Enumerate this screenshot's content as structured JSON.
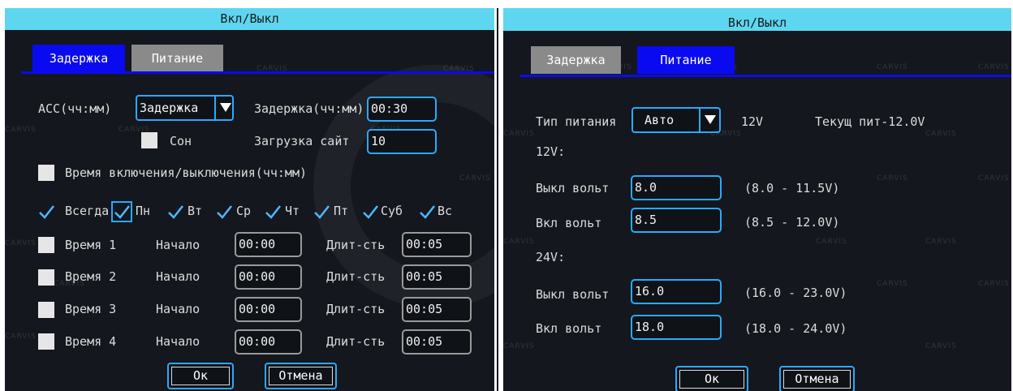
{
  "left": {
    "title": "Вкл/Выкл",
    "tabs": {
      "delay": "Задержка",
      "power": "Питание"
    },
    "acc_label": "ACC(чч:мм)",
    "acc_mode": "Задержка",
    "delay_label": "Задержка(чч:мм)",
    "delay_value": "00:30",
    "sleep_label": "Сон",
    "upload_label": "Загрузка сайт",
    "upload_value": "10",
    "schedule_label": "Время включения/выключения(чч:мм)",
    "days": {
      "always": "Всегда",
      "mon": "Пн",
      "tue": "Вт",
      "wed": "Ср",
      "thu": "Чт",
      "fri": "Пт",
      "sat": "Суб",
      "sun": "Вс"
    },
    "time_rows": [
      {
        "label": "Время 1",
        "start_label": "Начало",
        "start": "00:00",
        "dur_label": "Длит-сть",
        "dur": "00:05"
      },
      {
        "label": "Время 2",
        "start_label": "Начало",
        "start": "00:00",
        "dur_label": "Длит-сть",
        "dur": "00:05"
      },
      {
        "label": "Время 3",
        "start_label": "Начало",
        "start": "00:00",
        "dur_label": "Длит-сть",
        "dur": "00:05"
      },
      {
        "label": "Время 4",
        "start_label": "Начало",
        "start": "00:00",
        "dur_label": "Длит-сть",
        "dur": "00:05"
      }
    ],
    "ok": "Ок",
    "cancel": "Отмена"
  },
  "right": {
    "title": "Вкл/Выкл",
    "tabs": {
      "delay": "Задержка",
      "power": "Питание"
    },
    "power_type_label": "Тип питания",
    "power_type_value": "Авто",
    "power_voltage": "12V",
    "current_voltage": "Текущ пит-12.0V",
    "v12_header": "12V:",
    "v12_off_label": "Выкл вольт",
    "v12_off_value": "8.0",
    "v12_off_range": "(8.0 - 11.5V)",
    "v12_on_label": "Вкл вольт",
    "v12_on_value": "8.5",
    "v12_on_range": "(8.5 - 12.0V)",
    "v24_header": "24V:",
    "v24_off_label": "Выкл вольт",
    "v24_off_value": "16.0",
    "v24_off_range": "(16.0 - 23.0V)",
    "v24_on_label": "Вкл вольт",
    "v24_on_value": "18.0",
    "v24_on_range": "(18.0 - 24.0V)",
    "ok": "Ок",
    "cancel": "Отмена"
  },
  "watermark": "CARVIS",
  "colors": {
    "background": "#14171d",
    "titlebar": "#5fd6f0",
    "accent_blue": "#2aa9ff",
    "tab_active": "#0a0af0",
    "tab_inactive": "#8a8a8a"
  },
  "icons": {
    "check": "check-icon",
    "dropdown": "triangle-down-icon"
  }
}
